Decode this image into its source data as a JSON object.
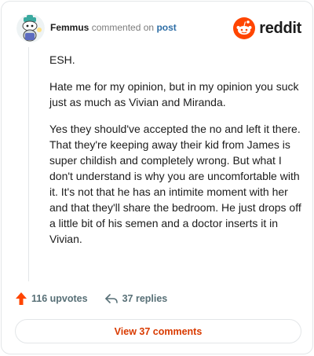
{
  "header": {
    "username": "Femmus",
    "verb": "commented on",
    "post_link": "post",
    "brand": "reddit"
  },
  "comment": {
    "paragraphs": [
      "ESH.",
      "Hate me for my opinion, but in my opinion you suck just as much as Vivian and Miranda.",
      "Yes they should've accepted the no and left it there. That they're keeping away their kid from James is super childish and completely wrong. But what I don't understand is why you are uncomfortable with it. It's not that he has an intimite moment with her and that they'll share the bedroom. He just drops off a little bit of his semen and a doctor inserts it in Vivian."
    ]
  },
  "actions": {
    "upvotes": "116 upvotes",
    "replies": "37 replies"
  },
  "footer": {
    "view_comments": "View 37 comments"
  },
  "colors": {
    "brand_orange": "#ff4500",
    "link_blue": "#2e6ea6",
    "button_text": "#d93a00"
  },
  "icons": {
    "upvote": "upvote-arrow-icon",
    "reply": "reply-arrow-icon",
    "logo": "reddit-snoo-icon"
  }
}
